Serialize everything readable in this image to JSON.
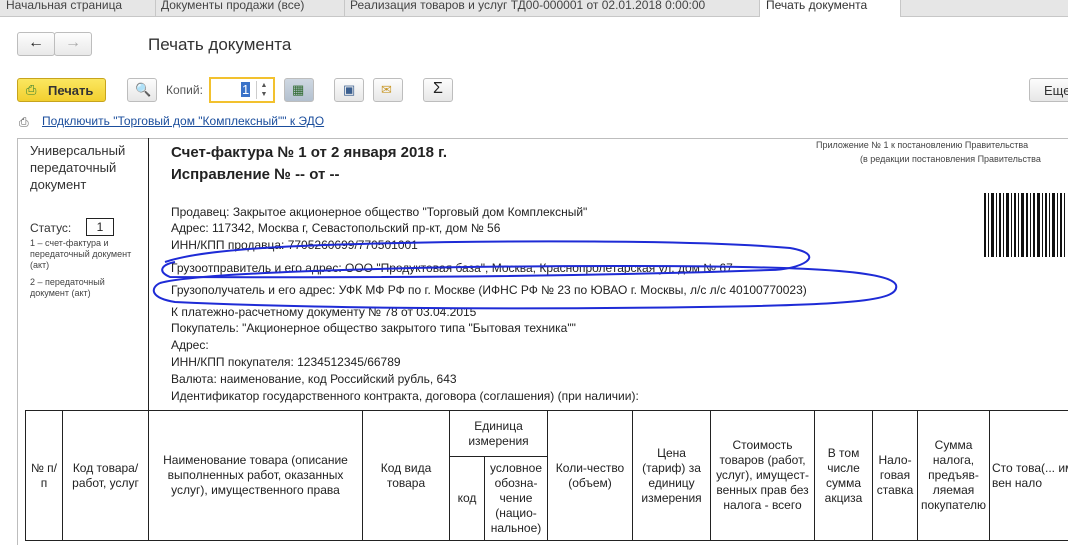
{
  "tabs": [
    "Начальная страница",
    "Документы продажи (все)",
    "Реализация товаров и услуг ТД00-000001 от 02.01.2018 0:00:00",
    "Печать документа"
  ],
  "page_title": "Печать документа",
  "toolbar": {
    "print_label": "Печать",
    "copies_label": "Копий:",
    "copies_value": "1",
    "more_label": "Еще",
    "sigma_label": "Σ"
  },
  "edo_link": "Подключить \"Торговый дом \"Комплексный\"\" к ЭДО",
  "upd": {
    "title": "Универсальный передаточный документ",
    "status_label": "Статус:",
    "status_value": "1",
    "note1": "1 – счет-фактура и передаточный документ (акт)",
    "note2": "2 – передаточный документ (акт)"
  },
  "header_right": {
    "line1": "Приложение № 1 к постановлению Правительства",
    "line2": "(в редакции постановления Правительства"
  },
  "invoice": {
    "title": "Счет-фактура № 1 от 2 января 2018 г.",
    "correction": "Исправление № -- от --",
    "seller": "Продавец: Закрытое акционерное общество \"Торговый дом Комплексный\"",
    "address": "Адрес: 117342, Москва г, Севастопольский пр-кт, дом № 56",
    "inn_seller": "ИНН/КПП продавца: 7705260699/770501001",
    "shipper": "Грузоотправитель и его адрес: ООО \"Продуктовая база\", Москва, Краснопролетарская ул, дом № 67",
    "consignee": "Грузополучатель и его адрес: УФК МФ РФ по г. Москве (ИФНС РФ № 23 по ЮВАО г. Москвы, л/с л/с 40100770023)",
    "payment_doc": "К платежно-расчетному документу № 78 от 03.04.2015",
    "buyer": "Покупатель: \"Акционерное общество закрытого типа \"Бытовая техника\"\"",
    "buyer_address": "Адрес:",
    "inn_buyer": "ИНН/КПП покупателя: 1234512345/66789",
    "currency": "Валюта: наименование, код Российский рубль, 643",
    "contract_id": "Идентификатор государственного контракта, договора (соглашения) (при наличии):"
  },
  "table": {
    "col_num": "№ п/п",
    "col_code": "Код товара/ работ, услуг",
    "col_name": "Наименование товара (описание выполненных работ, оказанных услуг), имущественного права",
    "col_kind": "Код вида товара",
    "col_unit": "Единица измерения",
    "col_unit_code": "код",
    "col_unit_name": "условное обозна-чение (нацио-нальное)",
    "col_qty": "Коли-чество (объем)",
    "col_price": "Цена (тариф) за единицу измерения",
    "col_cost": "Стоимость товаров (работ, услуг), имущест-венных прав без налога - всего",
    "col_excise": "В том числе сумма акциза",
    "col_rate": "Нало-говая ставка",
    "col_tax": "Сумма налога, предъяв-ляемая покупателю",
    "col_last": "Сто това(... иму вен нало"
  }
}
